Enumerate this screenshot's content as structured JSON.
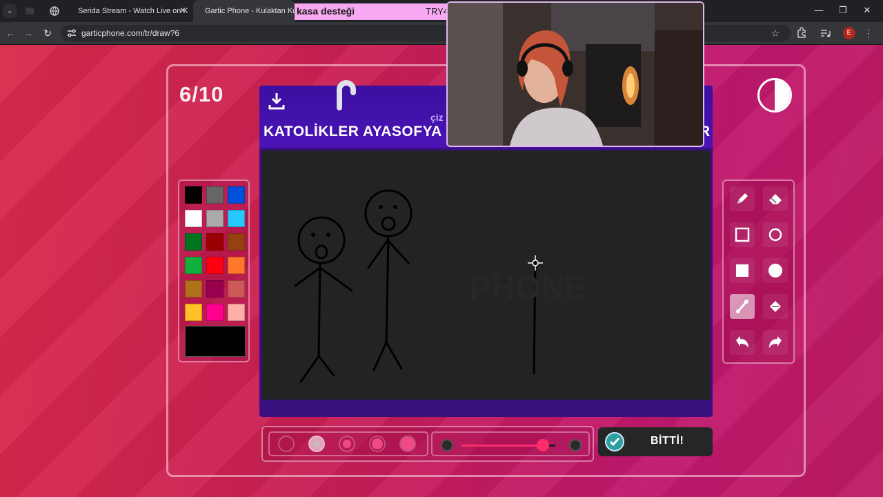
{
  "browser": {
    "tabs": [
      {
        "title": "Serida Stream - Watch Live on K",
        "close": "✕"
      },
      {
        "title": "Gartic Phone - Kulaktan Kulağa"
      }
    ],
    "url": "garticphone.com/tr/draw?6",
    "profile_initial": "E",
    "window_controls": {
      "minimize": "—",
      "maximize": "❐",
      "close": "✕"
    }
  },
  "game": {
    "round_counter": "6/10",
    "subtitle": "çiz",
    "prompt": "KATOLİKLER AYASOFYA",
    "prompt_tail": "R",
    "palette": [
      "#000000",
      "#666666",
      "#0050dc",
      "#ffffff",
      "#aaaaaa",
      "#26c9ff",
      "#017420",
      "#990000",
      "#964112",
      "#11b03c",
      "#ff0013",
      "#ff7829",
      "#b0701c",
      "#99004e",
      "#cb5a57",
      "#ffc126",
      "#ff008f",
      "#feafa8"
    ],
    "selected_color": "#000000",
    "tools": [
      "pencil-icon",
      "eraser-icon",
      "rect-outline-icon",
      "ellipse-outline-icon",
      "rect-fill-icon",
      "ellipse-fill-icon",
      "line-icon",
      "fill-bucket-icon",
      "undo-icon",
      "redo-icon"
    ],
    "active_tool": "line-icon",
    "brush_sizes": 5,
    "selected_size_index": 1,
    "opacity": 0.87,
    "done_label": "BİTTİ!",
    "accent": "#ff2d6b"
  },
  "stream_overlay": {
    "banner_text": "kasa desteği",
    "banner_code": "TRY4"
  }
}
